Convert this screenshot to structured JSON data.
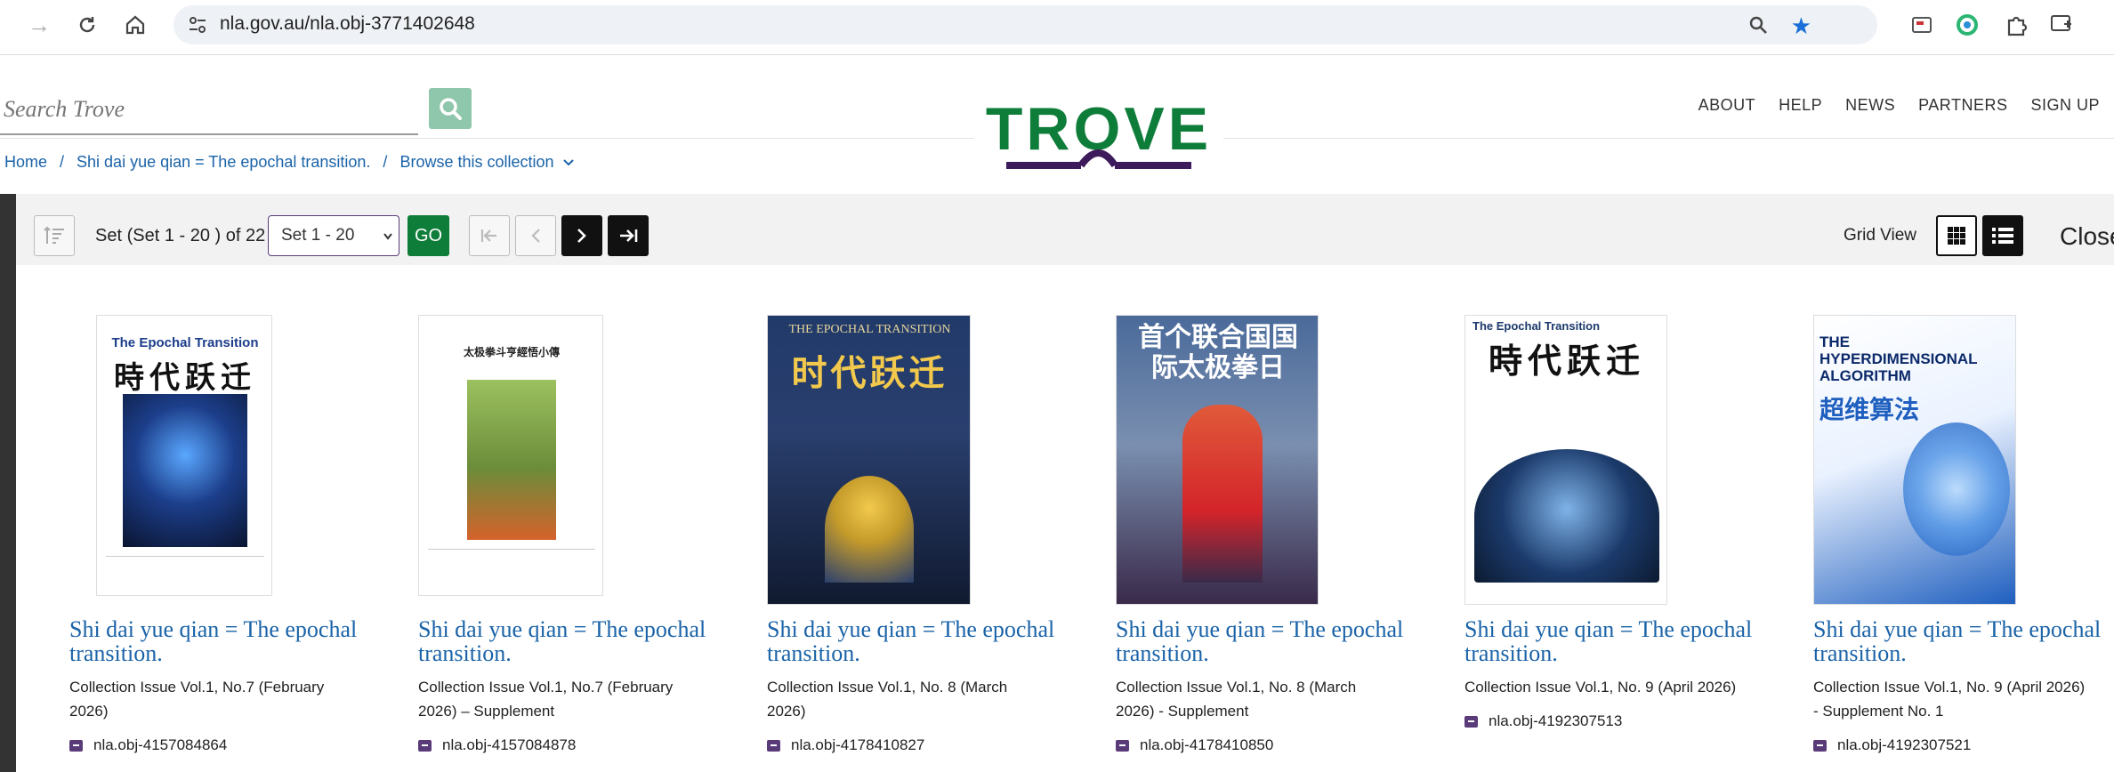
{
  "browser": {
    "url": "nla.gov.au/nla.obj-3771402648"
  },
  "header": {
    "search_placeholder": "Search Trove",
    "logo_text": "TROVE",
    "nav": [
      "ABOUT",
      "HELP",
      "NEWS",
      "PARTNERS",
      "SIGN UP"
    ]
  },
  "breadcrumb": {
    "home": "Home",
    "collection": "Shi dai yue qian = The epochal transition.",
    "browse": "Browse this collection"
  },
  "toolbar": {
    "set_label": "Set (Set 1 - 20 ) of 22",
    "set_select": "Set 1 - 20",
    "go": "GO",
    "grid_view": "Grid View",
    "close": "Close"
  },
  "items": [
    {
      "title": "Shi dai yue qian = The epochal transition.",
      "subtitle": "Collection Issue Vol.1, No.7 (February 2026)",
      "id": "nla.obj-4157084864",
      "cover_text": "The Epochal Transition",
      "cover_cn": "時代跃迁",
      "cover_accent": "#1c3e8a"
    },
    {
      "title": "Shi dai yue qian = The epochal transition.",
      "subtitle": "Collection Issue Vol.1, No.7 (February 2026) – Supplement",
      "id": "nla.obj-4157084878",
      "cover_text": "",
      "cover_cn": "太极拳斗亨經悟小傳",
      "cover_accent": "#6b8d3a"
    },
    {
      "title": "Shi dai yue qian = The epochal transition.",
      "subtitle": "Collection Issue Vol.1, No. 8 (March 2026)",
      "id": "nla.obj-4178410827",
      "cover_text": "THE EPOCHAL TRANSITION",
      "cover_cn": "时代跃迁",
      "cover_accent": "#2a3f6e"
    },
    {
      "title": "Shi dai yue qian = The epochal transition.",
      "subtitle": "Collection Issue Vol.1, No. 8 (March 2026) - Supplement",
      "id": "nla.obj-4178410850",
      "cover_text": "",
      "cover_cn": "首个联合国国际太极拳日",
      "cover_accent": "#a52a2a"
    },
    {
      "title": "Shi dai yue qian = The epochal transition.",
      "subtitle": "Collection Issue Vol.1, No. 9 (April 2026)",
      "id": "nla.obj-4192307513",
      "cover_text": "The Epochal Transition",
      "cover_cn": "時代跃迁",
      "cover_accent": "#1b3a6b"
    },
    {
      "title": "Shi dai yue qian = The epochal transition.",
      "subtitle": "Collection Issue Vol.1, No. 9 (April 2026) - Supplement No. 1",
      "id": "nla.obj-4192307521",
      "cover_text": "THE HYPERDIMENSIONAL ALGORITHM",
      "cover_cn": "超维算法",
      "cover_accent": "#1f5fbf"
    }
  ],
  "colors": {
    "brand_green": "#0f7d3a",
    "brand_purple": "#3d1a5b",
    "link_blue": "#1a63a8"
  }
}
